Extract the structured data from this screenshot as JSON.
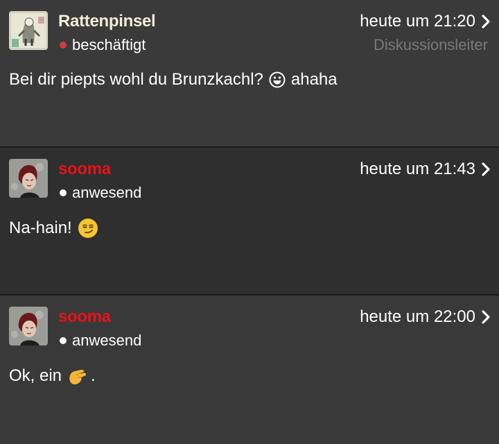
{
  "posts": [
    {
      "username": "Rattenpinsel",
      "username_color": "#f3ecd6",
      "status": "beschäftigt",
      "status_dot_color": "#d23c3c",
      "time": "heute um 21:20",
      "role": "Diskussionsleiter",
      "text_before": "Bei dir piepts wohl du Brunzkachl?",
      "emoji_icon": "grinning-face-outline-icon",
      "text_after": "ahaha"
    },
    {
      "username": "sooma",
      "username_color": "#e3141b",
      "status": "anwesend",
      "status_dot_color": "#ffffff",
      "time": "heute um 21:43",
      "text_before": "Na-hain!",
      "emoji_icon": "smirking-face-icon"
    },
    {
      "username": "sooma",
      "username_color": "#e3141b",
      "status": "anwesend",
      "status_dot_color": "#ffffff",
      "time": "heute um 22:00",
      "text_before": "Ok, ein",
      "emoji_icon": "pinching-hand-icon",
      "text_after": "."
    }
  ]
}
